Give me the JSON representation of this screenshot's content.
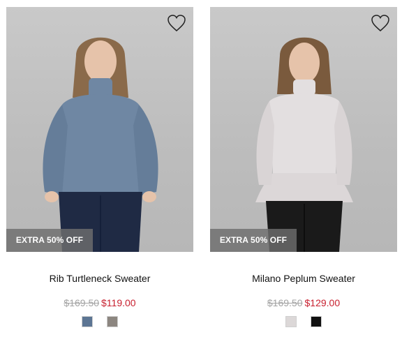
{
  "products": [
    {
      "name": "Rib Turtleneck Sweater",
      "badge": "EXTRA 50% OFF",
      "original_price": "$169.50",
      "sale_price": "$119.00",
      "swatches": [
        {
          "name": "blue heather",
          "color": "#5c7593"
        },
        {
          "name": "grey heather",
          "color": "#8c8680"
        }
      ],
      "sweater_color": "#6f87a3",
      "pants_color": "#1f2a44"
    },
    {
      "name": "Milano Peplum Sweater",
      "badge": "EXTRA 50% OFF",
      "original_price": "$169.50",
      "sale_price": "$129.00",
      "swatches": [
        {
          "name": "light grey",
          "color": "#dcd8d8"
        },
        {
          "name": "black",
          "color": "#111111"
        }
      ],
      "sweater_color": "#e3dfe0",
      "pants_color": "#1a1a1a"
    }
  ],
  "colors": {
    "sale": "#c8202f",
    "original": "#a3a3a3",
    "badge_bg": "rgba(110,110,110,0.82)"
  },
  "icons": {
    "wishlist": "heart-outline-icon"
  }
}
